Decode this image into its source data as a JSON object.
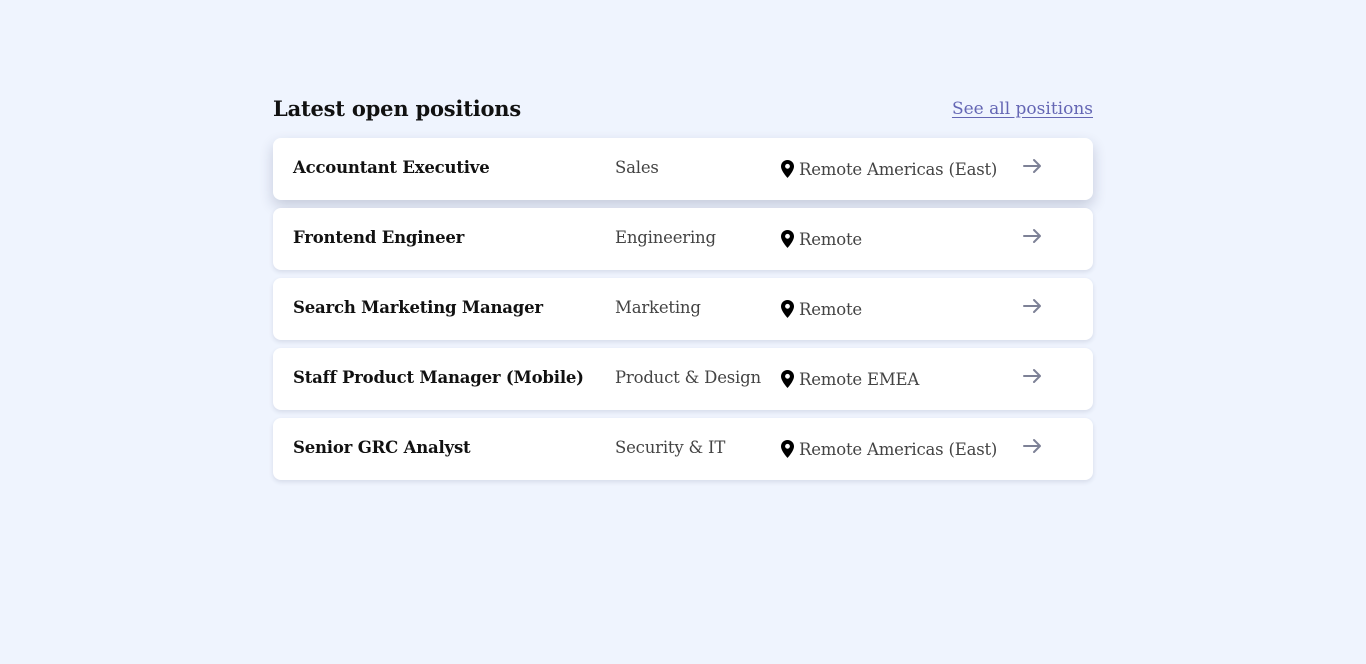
{
  "section": {
    "title": "Latest open positions",
    "see_all_label": "See all positions"
  },
  "positions": [
    {
      "title": "Accountant Executive",
      "department": "Sales",
      "location": "Remote Americas (East)"
    },
    {
      "title": "Frontend Engineer",
      "department": "Engineering",
      "location": "Remote"
    },
    {
      "title": "Search Marketing Manager",
      "department": "Marketing",
      "location": "Remote"
    },
    {
      "title": "Staff Product Manager (Mobile)",
      "department": "Product & Design",
      "location": "Remote EMEA"
    },
    {
      "title": "Senior GRC Analyst",
      "department": "Security & IT",
      "location": "Remote Americas (East)"
    }
  ],
  "icons": {
    "location": "map-pin-icon",
    "open": "arrow-right-icon"
  },
  "colors": {
    "background": "#eff4fe",
    "link": "#6466b4",
    "card": "#ffffff",
    "arrow": "#7d8196"
  }
}
